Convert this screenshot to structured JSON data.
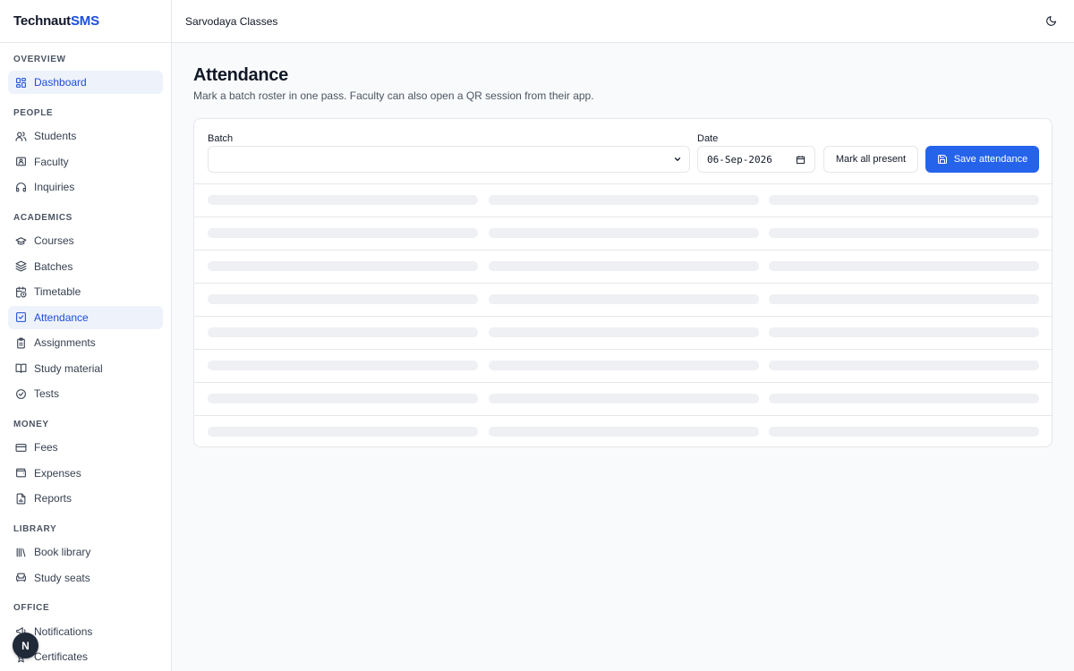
{
  "brand": {
    "part1": "Technaut",
    "part2": "SMS"
  },
  "org_name": "Sarvodaya Classes",
  "sidebar": {
    "sections": [
      {
        "label": "OVERVIEW",
        "items": [
          {
            "label": "Dashboard",
            "icon": "dashboard-icon",
            "active": true
          }
        ]
      },
      {
        "label": "PEOPLE",
        "items": [
          {
            "label": "Students",
            "icon": "users-icon"
          },
          {
            "label": "Faculty",
            "icon": "id-card-icon"
          },
          {
            "label": "Inquiries",
            "icon": "headset-icon"
          }
        ]
      },
      {
        "label": "ACADEMICS",
        "items": [
          {
            "label": "Courses",
            "icon": "graduation-cap-icon"
          },
          {
            "label": "Batches",
            "icon": "layers-icon"
          },
          {
            "label": "Timetable",
            "icon": "calendar-clock-icon"
          },
          {
            "label": "Attendance",
            "icon": "check-square-icon",
            "active": true
          },
          {
            "label": "Assignments",
            "icon": "clipboard-icon"
          },
          {
            "label": "Study material",
            "icon": "book-open-icon"
          },
          {
            "label": "Tests",
            "icon": "check-circle-icon"
          }
        ]
      },
      {
        "label": "MONEY",
        "items": [
          {
            "label": "Fees",
            "icon": "credit-card-icon"
          },
          {
            "label": "Expenses",
            "icon": "wallet-icon"
          },
          {
            "label": "Reports",
            "icon": "file-chart-icon"
          }
        ]
      },
      {
        "label": "LIBRARY",
        "items": [
          {
            "label": "Book library",
            "icon": "library-icon"
          },
          {
            "label": "Study seats",
            "icon": "armchair-icon"
          }
        ]
      },
      {
        "label": "OFFICE",
        "items": [
          {
            "label": "Notifications",
            "icon": "megaphone-icon"
          },
          {
            "label": "Certificates",
            "icon": "award-icon"
          }
        ]
      }
    ]
  },
  "fab_label": "N",
  "page": {
    "title": "Attendance",
    "subtitle": "Mark a batch roster in one pass. Faculty can also open a QR session from their app."
  },
  "form": {
    "batch_label": "Batch",
    "batch_value": "",
    "date_label": "Date",
    "date_value": "06-Sep-2026",
    "mark_all_label": "Mark all present",
    "save_label": "Save attendance"
  },
  "colors": {
    "accent": "#2563eb",
    "active_bg": "#eef2fb",
    "active_text": "#1d4ed8",
    "skeleton": "#eef0f3"
  },
  "skeleton_rows": 8
}
